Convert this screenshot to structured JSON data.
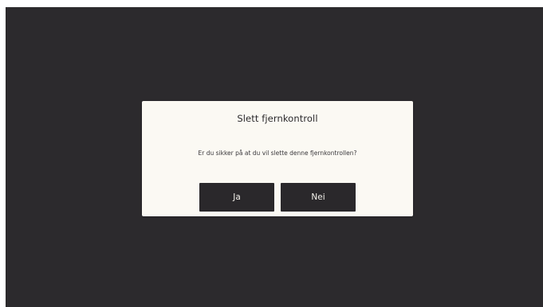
{
  "dialog": {
    "title": "Slett fjernkontroll",
    "message": "Er du sikker på at du vil slette denne fjernkontrollen?",
    "confirm_label": "Ja",
    "cancel_label": "Nei"
  },
  "colors": {
    "screen_background": "#2c2a2d",
    "dialog_background": "#fbf9f3",
    "button_background": "#2a282b",
    "button_text": "#f4f2ec"
  }
}
